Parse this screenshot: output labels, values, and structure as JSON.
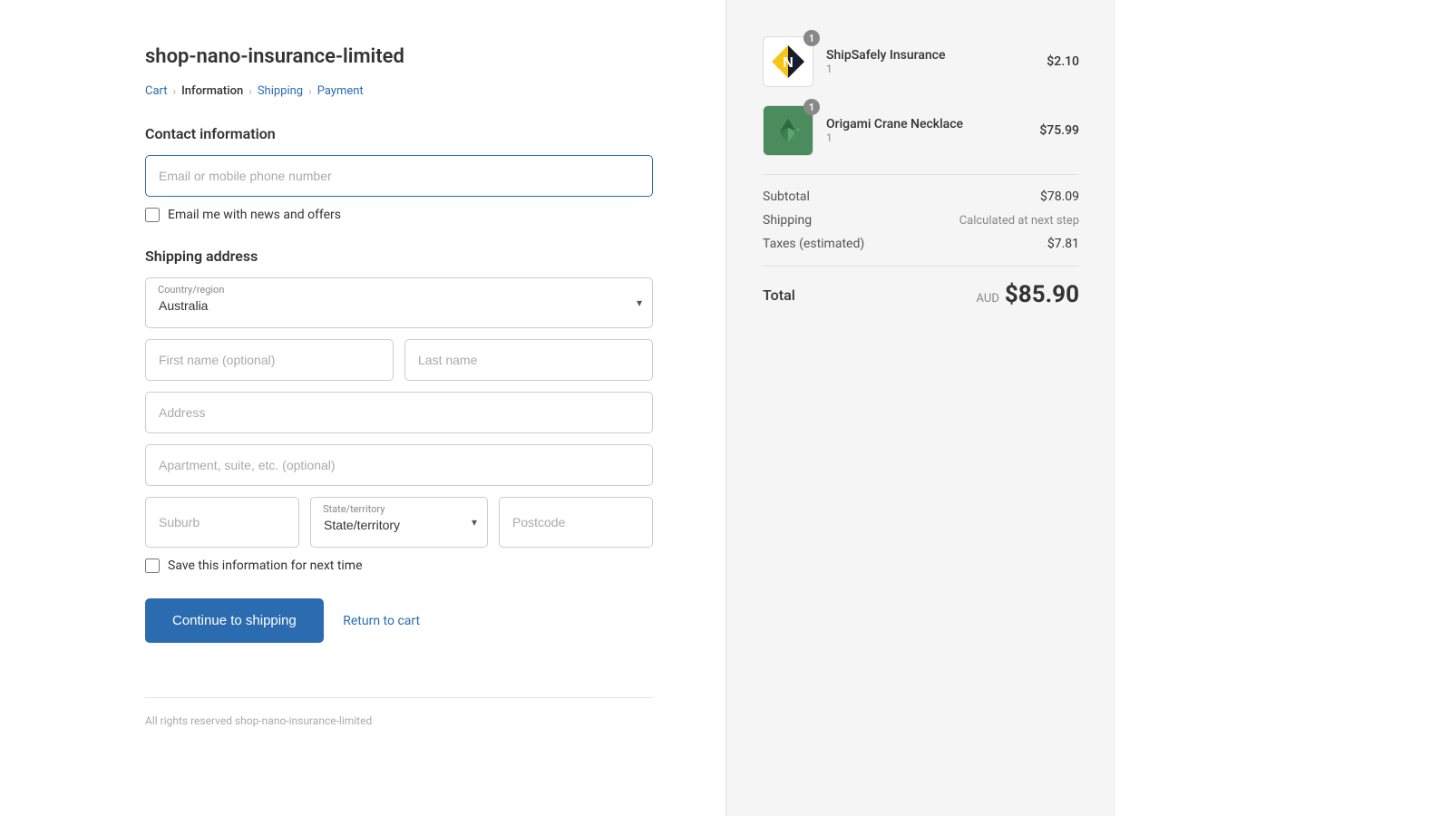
{
  "store": {
    "name": "shop-nano-insurance-limited",
    "footer": "All rights reserved shop-nano-insurance-limited"
  },
  "breadcrumb": {
    "cart": "Cart",
    "information": "Information",
    "shipping": "Shipping",
    "payment": "Payment"
  },
  "contact": {
    "section_title": "Contact information",
    "email_placeholder": "Email or mobile phone number",
    "newsletter_label": "Email me with news and offers"
  },
  "shipping": {
    "section_title": "Shipping address",
    "country_label": "Country/region",
    "country_value": "Australia",
    "first_name_placeholder": "First name (optional)",
    "last_name_placeholder": "Last name",
    "address_placeholder": "Address",
    "apartment_placeholder": "Apartment, suite, etc. (optional)",
    "suburb_placeholder": "Suburb",
    "state_label": "State/territory",
    "state_placeholder": "State/territory",
    "postcode_placeholder": "Postcode",
    "save_label": "Save this information for next time"
  },
  "buttons": {
    "continue": "Continue to shipping",
    "return": "Return to cart"
  },
  "order": {
    "items": [
      {
        "name": "ShipSafely Insurance",
        "qty": "1",
        "price": "$2.10",
        "badge": "1",
        "type": "shipsafely"
      },
      {
        "name": "Origami Crane Necklace",
        "qty": "1",
        "price": "$75.99",
        "badge": "1",
        "type": "origami"
      }
    ],
    "subtotal_label": "Subtotal",
    "subtotal_value": "$78.09",
    "shipping_label": "Shipping",
    "shipping_value": "Calculated at next step",
    "taxes_label": "Taxes (estimated)",
    "taxes_value": "$7.81",
    "total_label": "Total",
    "total_currency": "AUD",
    "total_amount": "$85.90"
  }
}
